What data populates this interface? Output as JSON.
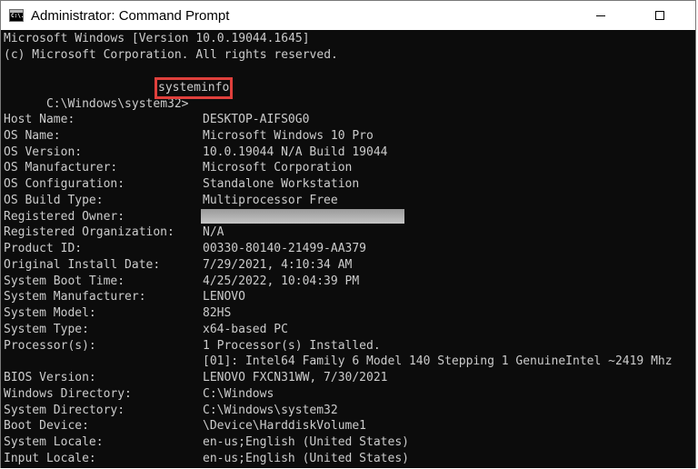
{
  "window": {
    "title": "Administrator: Command Prompt",
    "icon_glyph": "C:\\."
  },
  "console": {
    "header_line1": "Microsoft Windows [Version 10.0.19044.1645]",
    "header_line2": "(c) Microsoft Corporation. All rights reserved.",
    "prompt": "C:\\Windows\\system32>",
    "command": "systeminfo",
    "info": [
      {
        "label": "Host Name:",
        "value": "DESKTOP-AIFS0G0"
      },
      {
        "label": "OS Name:",
        "value": "Microsoft Windows 10 Pro"
      },
      {
        "label": "OS Version:",
        "value": "10.0.19044 N/A Build 19044"
      },
      {
        "label": "OS Manufacturer:",
        "value": "Microsoft Corporation"
      },
      {
        "label": "OS Configuration:",
        "value": "Standalone Workstation"
      },
      {
        "label": "OS Build Type:",
        "value": "Multiprocessor Free"
      },
      {
        "label": "Registered Owner:",
        "value": ""
      },
      {
        "label": "Registered Organization:",
        "value": "N/A"
      },
      {
        "label": "Product ID:",
        "value": "00330-80140-21499-AA379"
      },
      {
        "label": "Original Install Date:",
        "value": "7/29/2021, 4:10:34 AM"
      },
      {
        "label": "System Boot Time:",
        "value": "4/25/2022, 10:04:39 PM"
      },
      {
        "label": "System Manufacturer:",
        "value": "LENOVO"
      },
      {
        "label": "System Model:",
        "value": "82HS"
      },
      {
        "label": "System Type:",
        "value": "x64-based PC"
      },
      {
        "label": "Processor(s):",
        "value": "1 Processor(s) Installed."
      },
      {
        "label": "",
        "value": "[01]: Intel64 Family 6 Model 140 Stepping 1 GenuineIntel ~2419 Mhz"
      },
      {
        "label": "BIOS Version:",
        "value": "LENOVO FXCN31WW, 7/30/2021"
      },
      {
        "label": "Windows Directory:",
        "value": "C:\\Windows"
      },
      {
        "label": "System Directory:",
        "value": "C:\\Windows\\system32"
      },
      {
        "label": "Boot Device:",
        "value": "\\Device\\HarddiskVolume1"
      },
      {
        "label": "System Locale:",
        "value": "en-us;English (United States)"
      },
      {
        "label": "Input Locale:",
        "value": "en-us;English (United States)"
      }
    ]
  },
  "colors": {
    "console_bg": "#0c0c0c",
    "console_text": "#cccccc",
    "highlight_border": "#e0403c"
  },
  "icons": {
    "app": "cmd-icon",
    "minimize": "minimize-icon",
    "maximize": "maximize-icon"
  }
}
